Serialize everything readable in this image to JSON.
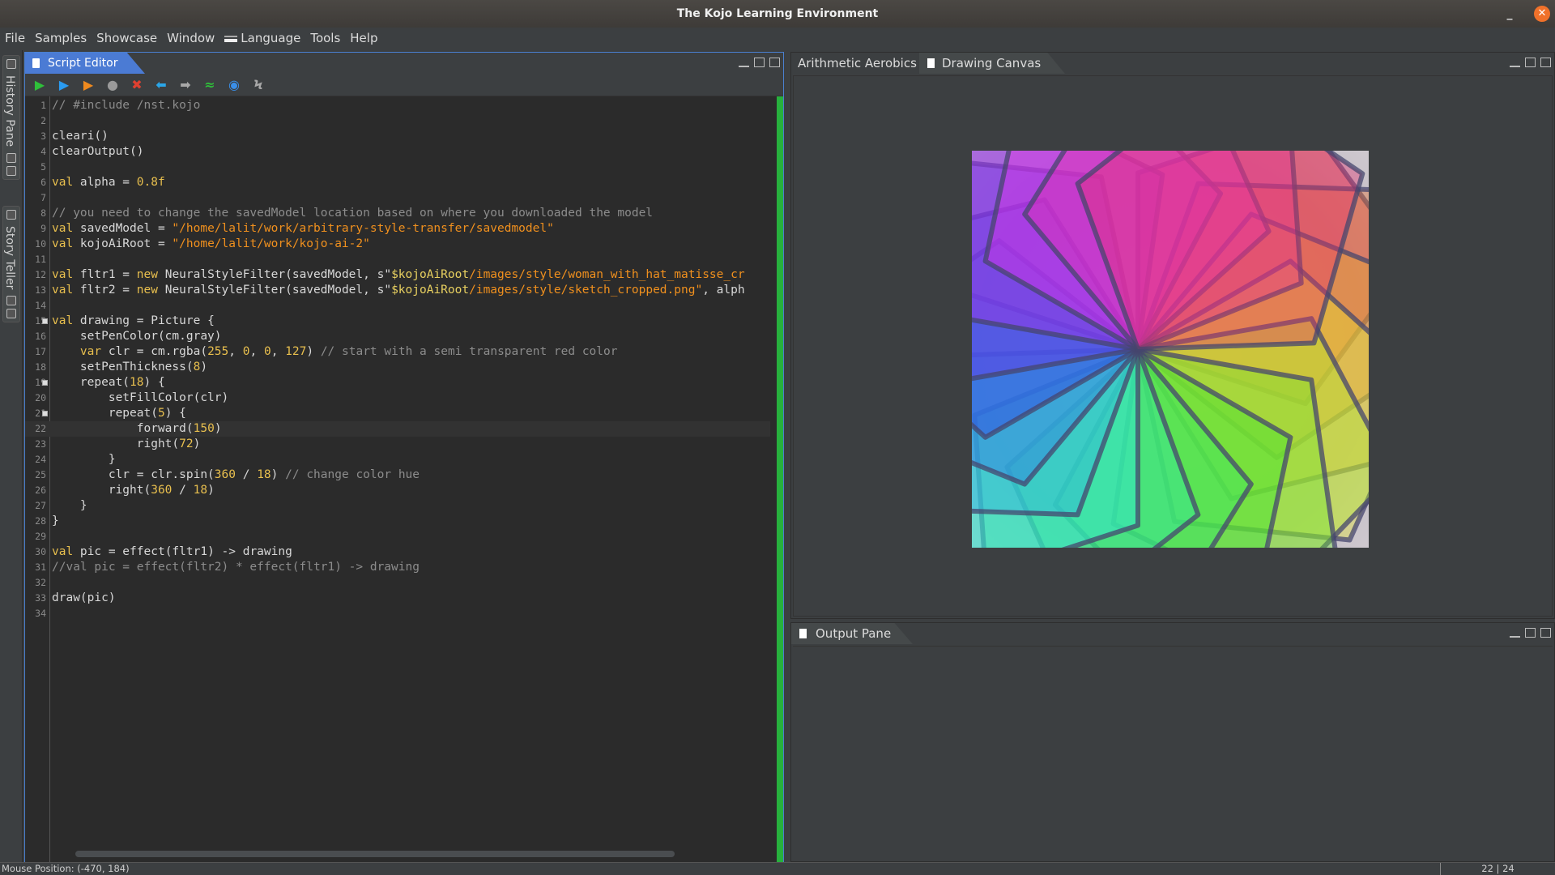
{
  "window": {
    "title": "The Kojo Learning Environment"
  },
  "menu": [
    "File",
    "Samples",
    "Showcase",
    "Window",
    "Language",
    "Tools",
    "Help"
  ],
  "left_strip": {
    "history": "History Pane",
    "story": "Story Teller"
  },
  "editor": {
    "tab": "Script Editor",
    "toolbar": [
      {
        "name": "run-icon",
        "glyph": "▶",
        "color": "#2fbf3a"
      },
      {
        "name": "run-worksheet-icon",
        "glyph": "▶",
        "color": "#2a9bf0"
      },
      {
        "name": "trace-icon",
        "glyph": "▶",
        "color": "#f08a1e"
      },
      {
        "name": "stop-icon",
        "glyph": "●",
        "color": "#9a9a9a"
      },
      {
        "name": "clear-icon",
        "glyph": "✖",
        "color": "#e04030"
      },
      {
        "name": "history-back-icon",
        "glyph": "⬅",
        "color": "#2aa6e8"
      },
      {
        "name": "history-forward-icon",
        "glyph": "➡",
        "color": "#a8a8a8"
      },
      {
        "name": "format-icon",
        "glyph": "≈",
        "color": "#2fbf3a"
      },
      {
        "name": "upload-icon",
        "glyph": "◉",
        "color": "#3a8fe8"
      },
      {
        "name": "compile-icon",
        "glyph": "Ϟ",
        "color": "#a8a8a8"
      }
    ],
    "current_line": 22,
    "lines": [
      [
        [
          "// #include /nst.kojo",
          "#8c8c8c"
        ]
      ],
      [],
      [
        [
          "cleari()",
          "#d8d8d8"
        ]
      ],
      [
        [
          "clearOutput()",
          "#d8d8d8"
        ]
      ],
      [],
      [
        [
          "val",
          "#e8bf4e"
        ],
        [
          " alpha = ",
          "#d8d8d8"
        ],
        [
          "0.8f",
          "#e8bf4e"
        ]
      ],
      [],
      [
        [
          "// you need to change the savedModel location based on where you downloaded the model",
          "#8c8c8c"
        ]
      ],
      [
        [
          "val",
          "#e8bf4e"
        ],
        [
          " savedModel = ",
          "#d8d8d8"
        ],
        [
          "\"/home/lalit/work/arbitrary-style-transfer/savedmodel\"",
          "#f0901e"
        ]
      ],
      [
        [
          "val",
          "#e8bf4e"
        ],
        [
          " kojoAiRoot = ",
          "#d8d8d8"
        ],
        [
          "\"/home/lalit/work/kojo-ai-2\"",
          "#f0901e"
        ]
      ],
      [],
      [
        [
          "val",
          "#e8bf4e"
        ],
        [
          " fltr1 = ",
          "#d8d8d8"
        ],
        [
          "new",
          "#e8bf4e"
        ],
        [
          " NeuralStyleFilter(savedModel, s\"",
          "#d8d8d8"
        ],
        [
          "$kojoAiRoot",
          "#e8d060"
        ],
        [
          "/images/style/woman_with_hat_matisse_cr",
          "#f0901e"
        ]
      ],
      [
        [
          "val",
          "#e8bf4e"
        ],
        [
          " fltr2 = ",
          "#d8d8d8"
        ],
        [
          "new",
          "#e8bf4e"
        ],
        [
          " NeuralStyleFilter(savedModel, s\"",
          "#d8d8d8"
        ],
        [
          "$kojoAiRoot",
          "#e8d060"
        ],
        [
          "/images/style/sketch_cropped.png\"",
          "#f0901e"
        ],
        [
          ", alph",
          "#d8d8d8"
        ]
      ],
      [],
      [
        [
          "val",
          "#e8bf4e"
        ],
        [
          " drawing = Picture {",
          "#d8d8d8"
        ]
      ],
      [
        [
          "    setPenColor(cm.gray)",
          "#d8d8d8"
        ]
      ],
      [
        [
          "    ",
          "#d8d8d8"
        ],
        [
          "var",
          "#e8bf4e"
        ],
        [
          " clr = cm.rgba(",
          "#d8d8d8"
        ],
        [
          "255",
          "#e8bf4e"
        ],
        [
          ", ",
          "#d8d8d8"
        ],
        [
          "0",
          "#e8bf4e"
        ],
        [
          ", ",
          "#d8d8d8"
        ],
        [
          "0",
          "#e8bf4e"
        ],
        [
          ", ",
          "#d8d8d8"
        ],
        [
          "127",
          "#e8bf4e"
        ],
        [
          ") ",
          "#d8d8d8"
        ],
        [
          "// start with a semi transparent red color",
          "#8c8c8c"
        ]
      ],
      [
        [
          "    setPenThickness(",
          "#d8d8d8"
        ],
        [
          "8",
          "#e8bf4e"
        ],
        [
          ")",
          "#d8d8d8"
        ]
      ],
      [
        [
          "    repeat(",
          "#d8d8d8"
        ],
        [
          "18",
          "#e8bf4e"
        ],
        [
          ") {",
          "#d8d8d8"
        ]
      ],
      [
        [
          "        setFillColor(clr)",
          "#d8d8d8"
        ]
      ],
      [
        [
          "        repeat(",
          "#d8d8d8"
        ],
        [
          "5",
          "#e8bf4e"
        ],
        [
          ") {",
          "#d8d8d8"
        ]
      ],
      [
        [
          "            forward(",
          "#d8d8d8"
        ],
        [
          "150",
          "#e8bf4e"
        ],
        [
          ")",
          "#d8d8d8"
        ]
      ],
      [
        [
          "            right(",
          "#d8d8d8"
        ],
        [
          "72",
          "#e8bf4e"
        ],
        [
          ")",
          "#d8d8d8"
        ]
      ],
      [
        [
          "        }",
          "#d8d8d8"
        ]
      ],
      [
        [
          "        clr = clr.spin(",
          "#d8d8d8"
        ],
        [
          "360",
          "#e8bf4e"
        ],
        [
          " / ",
          "#d8d8d8"
        ],
        [
          "18",
          "#e8bf4e"
        ],
        [
          ") ",
          "#d8d8d8"
        ],
        [
          "// change color hue",
          "#8c8c8c"
        ]
      ],
      [
        [
          "        right(",
          "#d8d8d8"
        ],
        [
          "360",
          "#e8bf4e"
        ],
        [
          " / ",
          "#d8d8d8"
        ],
        [
          "18",
          "#e8bf4e"
        ],
        [
          ")",
          "#d8d8d8"
        ]
      ],
      [
        [
          "    }",
          "#d8d8d8"
        ]
      ],
      [
        [
          "}",
          "#d8d8d8"
        ]
      ],
      [],
      [
        [
          "val",
          "#e8bf4e"
        ],
        [
          " pic = effect(fltr1) -> drawing",
          "#d8d8d8"
        ]
      ],
      [
        [
          "//val pic = effect(fltr2) * effect(fltr1) -> drawing",
          "#8c8c8c"
        ]
      ],
      [],
      [
        [
          "draw(pic)",
          "#d8d8d8"
        ]
      ],
      []
    ],
    "fold_lines": [
      15,
      19,
      21
    ]
  },
  "canvas": {
    "tabs": [
      "Arithmetic Aerobics",
      "Drawing Canvas"
    ],
    "active_tab": "Drawing Canvas",
    "figure": {
      "repeats": 18,
      "sides": 5,
      "side_length": 150,
      "hue_step": 20,
      "pen_color": "gray",
      "pen_thickness": 8,
      "start_color": "#ff000080"
    }
  },
  "output": {
    "tab": "Output Pane"
  },
  "status": {
    "mouse": "Mouse Position: (-470, 184)",
    "cursor": "22 | 24"
  }
}
